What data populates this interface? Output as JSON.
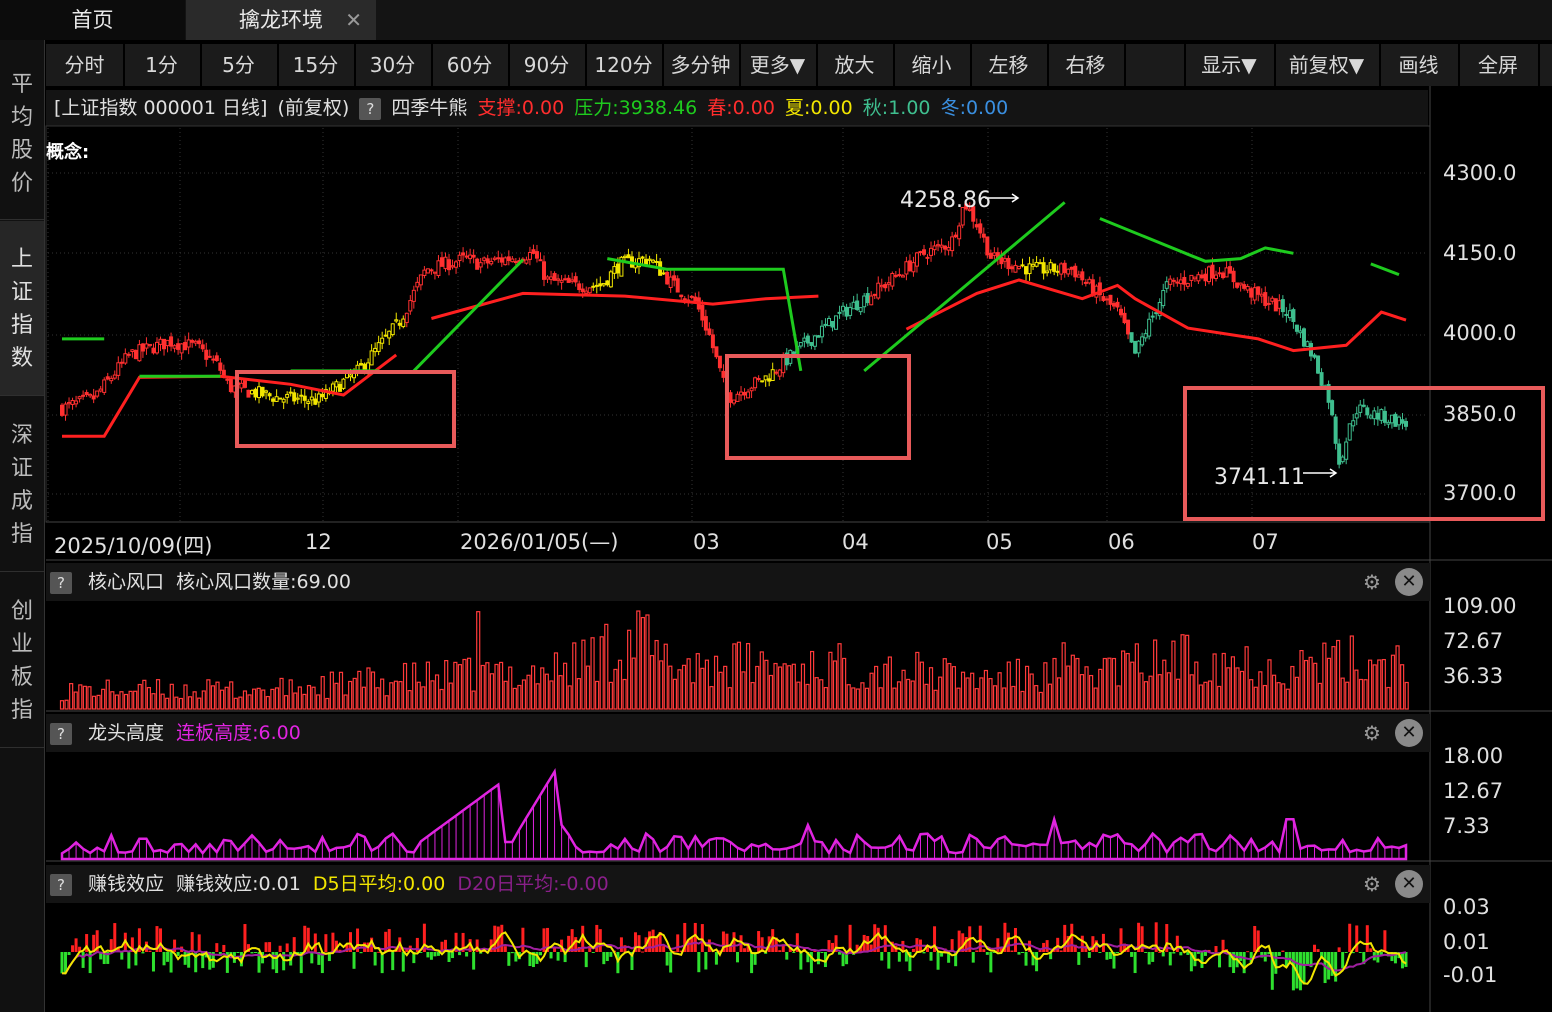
{
  "tabs": {
    "home": "首页",
    "env": "擒龙环境",
    "close": "✕"
  },
  "sidebar": [
    "平均股价",
    "上证指数",
    "深证成指",
    "创业板指"
  ],
  "toolbar": [
    "分时",
    "1分",
    "5分",
    "15分",
    "30分",
    "60分",
    "90分",
    "120分",
    "多分钟",
    "更多▼",
    "放大",
    "缩小",
    "左移",
    "右移",
    "显示▼",
    "前复权▼",
    "画线",
    "全屏"
  ],
  "info": {
    "symbol": "[上证指数 000001 日线]",
    "adj": "(前复权)",
    "help": "?",
    "indicator": "四季牛熊",
    "support": "支撑:0.00",
    "pressure": "压力:3938.46",
    "spring": "春:0.00",
    "summer": "夏:0.00",
    "autumn": "秋:1.00",
    "winter": "冬:0.00"
  },
  "concept": "概念:",
  "main_chart": {
    "high_label": "4258.86",
    "low_label": "3741.11",
    "y_ticks": [
      "4300.0",
      "4150.0",
      "4000.0",
      "3850.0",
      "3700.0"
    ],
    "dates": [
      "2025/10/09(四)",
      "12",
      "2026/01/05(—)",
      "03",
      "04",
      "05",
      "06",
      "07"
    ]
  },
  "panel1": {
    "help": "?",
    "name": "核心风口",
    "value": "核心风口数量:69.00",
    "y_ticks": [
      "109.00",
      "72.67",
      "36.33"
    ]
  },
  "panel2": {
    "help": "?",
    "name": "龙头高度",
    "value": "连板高度:6.00",
    "y_ticks": [
      "18.00",
      "12.67",
      "7.33"
    ]
  },
  "panel3": {
    "help": "?",
    "name": "赚钱效应",
    "value": "赚钱效应:0.01",
    "d5": "D5日平均:0.00",
    "d20": "D20日平均:-0.00",
    "y_ticks": [
      "0.03",
      "0.01",
      "-0.01"
    ]
  },
  "icons": {
    "gear": "⚙",
    "close": "✕"
  },
  "colors": {
    "red": "#ff2d2d",
    "green": "#1ecb1e",
    "yellow": "#f2e600",
    "magenta": "#e024e0",
    "teal": "#3fbf8f",
    "highlight": "#e85a5a"
  },
  "chart_data": [
    {
      "type": "candlestick",
      "title": "上证指数 000001 日线",
      "y_ticks": [
        4300,
        4150,
        4000,
        3850,
        3700
      ],
      "ylim": [
        3680,
        4330
      ],
      "annotations": [
        {
          "text": "4258.86",
          "value": 4258.86
        },
        {
          "text": "3741.11",
          "value": 3741.11
        }
      ],
      "series": [
        {
          "name": "支撑",
          "values_anchor": [
            [
              0,
              3808
            ],
            [
              12,
              3808
            ],
            [
              22,
              3918
            ],
            [
              45,
              3920
            ],
            [
              65,
              3905
            ],
            [
              80,
              3885
            ],
            [
              95,
              3960
            ],
            [
              105,
              4028
            ],
            [
              131,
              4075
            ],
            [
              160,
              4070
            ],
            [
              185,
              4055
            ],
            [
              200,
              4065
            ],
            [
              215,
              4070
            ],
            [
              240,
              4008
            ],
            [
              260,
              4075
            ],
            [
              272,
              4100
            ],
            [
              290,
              4065
            ],
            [
              300,
              4090
            ],
            [
              305,
              4065
            ],
            [
              320,
              4010
            ],
            [
              340,
              3990
            ],
            [
              350,
              3968
            ],
            [
              365,
              3978
            ],
            [
              375,
              4040
            ],
            [
              382,
              4025
            ]
          ]
        },
        {
          "name": "压力",
          "values_anchor": [
            [
              0,
              3990
            ],
            [
              12,
              3990
            ],
            [
              22,
              3920
            ],
            [
              45,
              3920
            ],
            [
              65,
              3930
            ],
            [
              90,
              3930
            ],
            [
              100,
              3930
            ],
            [
              131,
              4138
            ],
            [
              155,
              4140
            ],
            [
              172,
              4120
            ],
            [
              205,
              4120
            ],
            [
              210,
              3930
            ],
            [
              228,
              3930
            ],
            [
              285,
              4245
            ],
            [
              295,
              4215
            ],
            [
              320,
              4148
            ],
            [
              325,
              4135
            ],
            [
              335,
              4140
            ],
            [
              342,
              4160
            ],
            [
              350,
              4150
            ],
            [
              372,
              4130
            ],
            [
              380,
              4110
            ]
          ]
        }
      ]
    },
    {
      "type": "bar",
      "title": "核心风口",
      "y_ticks": [
        109.0,
        72.67,
        36.33
      ],
      "ylim": [
        0,
        115
      ]
    },
    {
      "type": "area",
      "title": "龙头高度",
      "y_ticks": [
        18.0,
        12.67,
        7.33
      ],
      "ylim": [
        0,
        19
      ]
    },
    {
      "type": "bar",
      "title": "赚钱效应",
      "y_ticks": [
        0.03,
        0.01,
        -0.01
      ],
      "ylim": [
        -0.025,
        0.035
      ]
    }
  ]
}
